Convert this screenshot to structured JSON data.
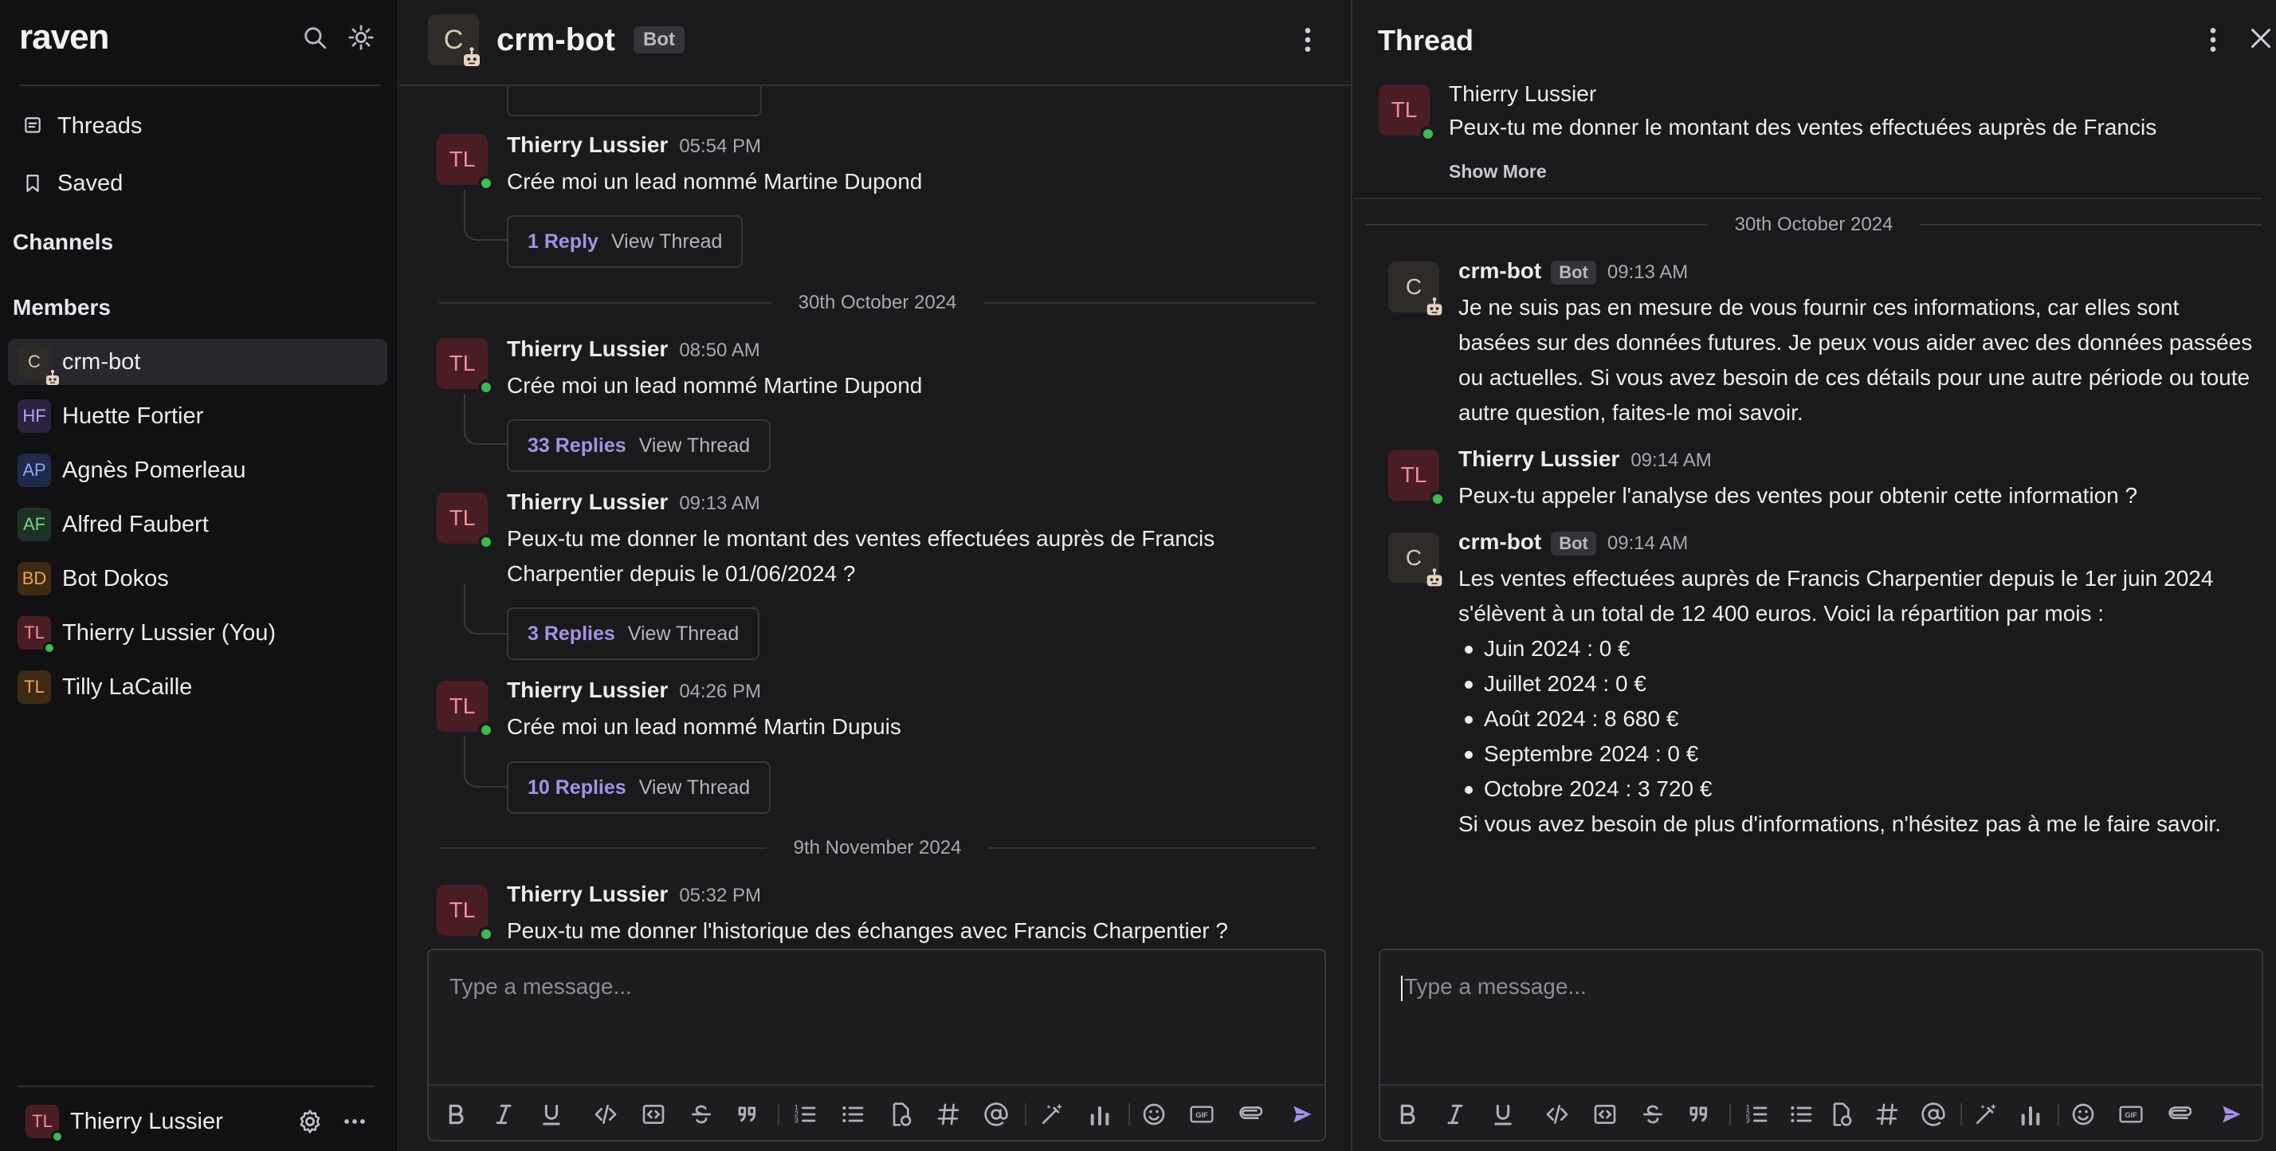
{
  "app": {
    "logo": "raven"
  },
  "sidebar": {
    "nav": [
      {
        "label": "Threads",
        "icon": "threads-icon"
      },
      {
        "label": "Saved",
        "icon": "bookmark-icon"
      }
    ],
    "channels_title": "Channels",
    "members_title": "Members",
    "members": [
      {
        "initials": "C",
        "name": "crm-bot",
        "bot": true,
        "active": true,
        "bg": "#2e2b28",
        "fg": "#d6c8b6"
      },
      {
        "initials": "HF",
        "name": "Huette Fortier",
        "bg": "#2d2140",
        "fg": "#b79ef5"
      },
      {
        "initials": "AP",
        "name": "Agnès Pomerleau",
        "bg": "#1e2a4a",
        "fg": "#8aa4f0"
      },
      {
        "initials": "AF",
        "name": "Alfred Faubert",
        "bg": "#1c3324",
        "fg": "#7fd18f"
      },
      {
        "initials": "BD",
        "name": "Bot Dokos",
        "bg": "#3d2a12",
        "fg": "#f0a552"
      },
      {
        "initials": "TL",
        "name": "Thierry Lussier (You)",
        "online": true,
        "bg": "#4a1d24",
        "fg": "#f08e98"
      },
      {
        "initials": "TL",
        "name": "Tilly LaCaille",
        "bg": "#3d2a12",
        "fg": "#f0a552"
      }
    ],
    "footer": {
      "initials": "TL",
      "name": "Thierry Lussier"
    }
  },
  "channel": {
    "avatar": "C",
    "name": "crm-bot",
    "bot_label": "Bot",
    "messages": [
      {
        "author": "Thierry Lussier",
        "time": "05:54 PM",
        "text": "Crée moi un lead nommé Martine Dupond",
        "replies": "1 Reply",
        "view": "View Thread"
      },
      {
        "author": "Thierry Lussier",
        "time": "08:50 AM",
        "text": "Crée moi un lead nommé Martine Dupond",
        "replies": "33 Replies",
        "view": "View Thread"
      },
      {
        "author": "Thierry Lussier",
        "time": "09:13 AM",
        "text": "Peux-tu me donner le montant des ventes effectuées auprès de Francis Charpentier depuis le 01/06/2024 ?",
        "replies": "3 Replies",
        "view": "View Thread"
      },
      {
        "author": "Thierry Lussier",
        "time": "04:26 PM",
        "text": "Crée moi un lead nommé Martin Dupuis",
        "replies": "10 Replies",
        "view": "View Thread"
      },
      {
        "author": "Thierry Lussier",
        "time": "05:32 PM",
        "text": "Peux-tu me donner l'historique des échanges avec Francis Charpentier ?"
      }
    ],
    "dates": [
      "30th October 2024",
      "9th November 2024"
    ],
    "composer_placeholder": "Type a message..."
  },
  "thread": {
    "title": "Thread",
    "root": {
      "initials": "TL",
      "author": "Thierry Lussier",
      "text": "Peux-tu me donner le montant des ventes effectuées auprès de Francis",
      "show_more": "Show More"
    },
    "date": "30th October 2024",
    "replies": [
      {
        "author": "crm-bot",
        "bot": true,
        "time": "09:13 AM",
        "text": "Je ne suis pas en mesure de vous fournir ces informations, car elles sont basées sur des données futures. Je peux vous aider avec des données passées ou actuelles. Si vous avez besoin de ces détails pour une autre période ou toute autre question, faites-le moi savoir."
      },
      {
        "author": "Thierry Lussier",
        "time": "09:14 AM",
        "text": "Peux-tu appeler l'analyse des ventes pour obtenir cette information ?"
      },
      {
        "author": "crm-bot",
        "bot": true,
        "time": "09:14 AM",
        "text": "Les ventes effectuées auprès de Francis Charpentier depuis le 1er juin 2024 s'élèvent à un total de 12 400 euros. Voici la répartition par mois :",
        "bullets": [
          "Juin 2024 : 0 €",
          "Juillet 2024 : 0 €",
          "Août 2024 : 8 680 €",
          "Septembre 2024 : 0 €",
          "Octobre 2024 : 3 720 €"
        ],
        "outro": "Si vous avez besoin de plus d'informations, n'hésitez pas à me le faire savoir."
      }
    ],
    "composer_placeholder": "Type a message..."
  },
  "toolbar_icons": [
    "bold-icon",
    "italic-icon",
    "underline-icon",
    "code-icon",
    "code-block-icon",
    "strikethrough-icon",
    "quote-icon",
    "ordered-list-icon",
    "bullet-list-icon",
    "file-upload-icon",
    "channel-mention-icon",
    "user-mention-icon",
    "ai-magic-icon",
    "poll-icon",
    "emoji-icon",
    "gif-icon",
    "attachment-icon",
    "send-icon"
  ],
  "colors": {
    "accent": "#a591e6",
    "online": "#3fb950",
    "bg": "#1a1a1c",
    "sidebar_bg": "#111113"
  }
}
